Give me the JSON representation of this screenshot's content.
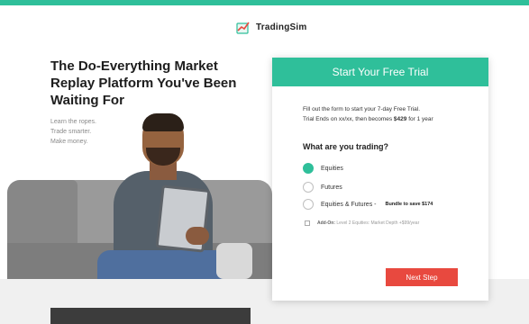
{
  "brand": {
    "name": "TradingSim",
    "accent": "#2fbf9a"
  },
  "hero": {
    "title": "The Do-Everything Market Replay Platform You've Been Waiting For",
    "taglines": [
      "Learn the ropes.",
      "Trade smarter.",
      "Make money."
    ]
  },
  "form": {
    "header": "Start Your Free Trial",
    "intro_line1": "Fill out the form to start your 7-day Free Trial.",
    "intro_line2_prefix": "Trial Ends on xx/xx, then becomes ",
    "intro_price": "$429",
    "intro_line2_suffix": " for 1 year",
    "question": "What are you trading?",
    "options": [
      {
        "label": "Equities",
        "selected": true
      },
      {
        "label": "Futures",
        "selected": false
      },
      {
        "label": "Equities & Futures - ",
        "selected": false,
        "note": "Bundle to save $174"
      }
    ],
    "addon_label": "Add-On:",
    "addon_text": " Level 2 Equities: Market Depth +$99/year",
    "next_button": "Next Step",
    "button_color": "#e8493f"
  }
}
